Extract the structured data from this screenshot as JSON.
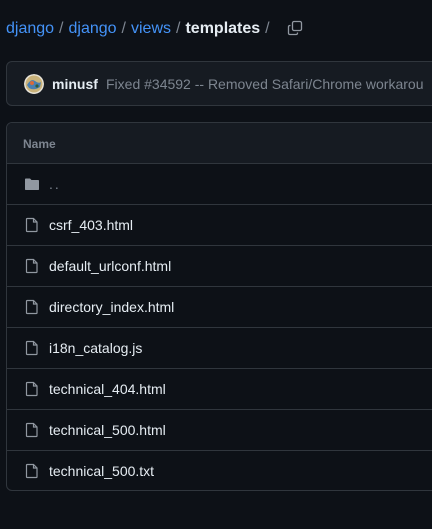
{
  "breadcrumb": {
    "items": [
      "django",
      "django",
      "views"
    ],
    "current": "templates",
    "separator": "/"
  },
  "icons": {
    "copy": "copy-icon",
    "folder": "folder-icon",
    "file": "file-icon"
  },
  "commit": {
    "author": "minusf",
    "message": "Fixed #34592 -- Removed Safari/Chrome workarou"
  },
  "table": {
    "header": "Name",
    "parent_dir": "..",
    "files": [
      "csrf_403.html",
      "default_urlconf.html",
      "directory_index.html",
      "i18n_catalog.js",
      "technical_404.html",
      "technical_500.html",
      "technical_500.txt"
    ]
  },
  "colors": {
    "background": "#0d1117",
    "link": "#4493f8",
    "text": "#e6edf3",
    "muted": "#7d8590",
    "border": "#30363d"
  }
}
